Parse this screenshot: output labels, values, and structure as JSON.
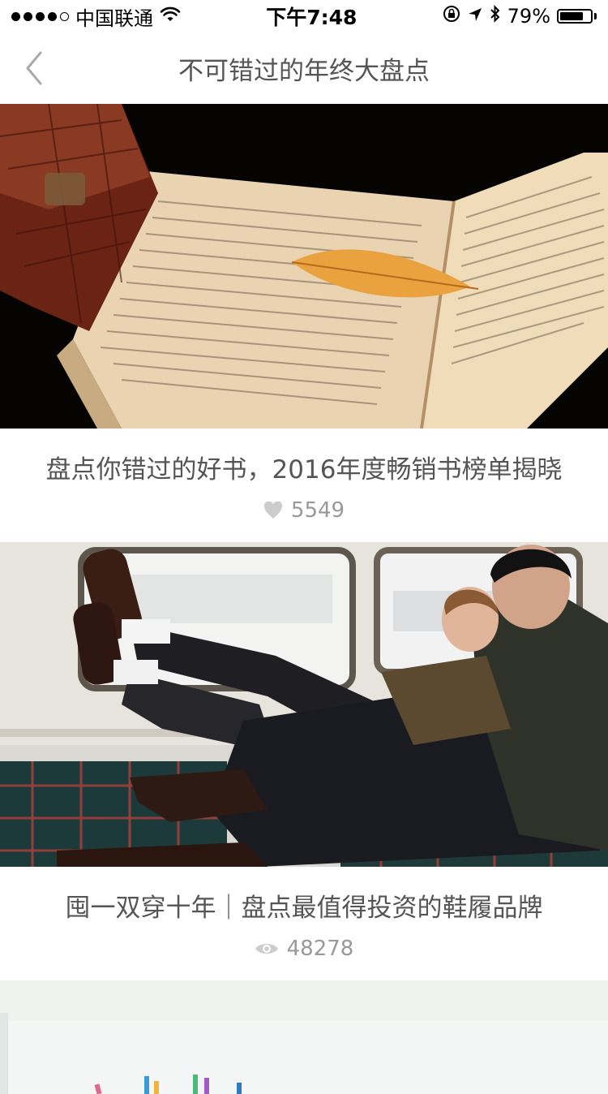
{
  "status_bar": {
    "carrier": "中国联通",
    "time": "下午7:48",
    "battery_percent": "79%",
    "battery_level": 0.79
  },
  "header": {
    "title": "不可错过的年终大盘点"
  },
  "articles": [
    {
      "title": "盘点你错过的好书，2016年度畅销书榜单揭晓",
      "count": "5549",
      "icon": "heart-icon"
    },
    {
      "title": "囤一双穿十年｜盘点最值得投资的鞋履品牌",
      "count": "48278",
      "icon": "eye-icon"
    }
  ],
  "colors": {
    "text_primary": "#555555",
    "text_meta": "#999999",
    "icon_gray": "#cccccc"
  }
}
